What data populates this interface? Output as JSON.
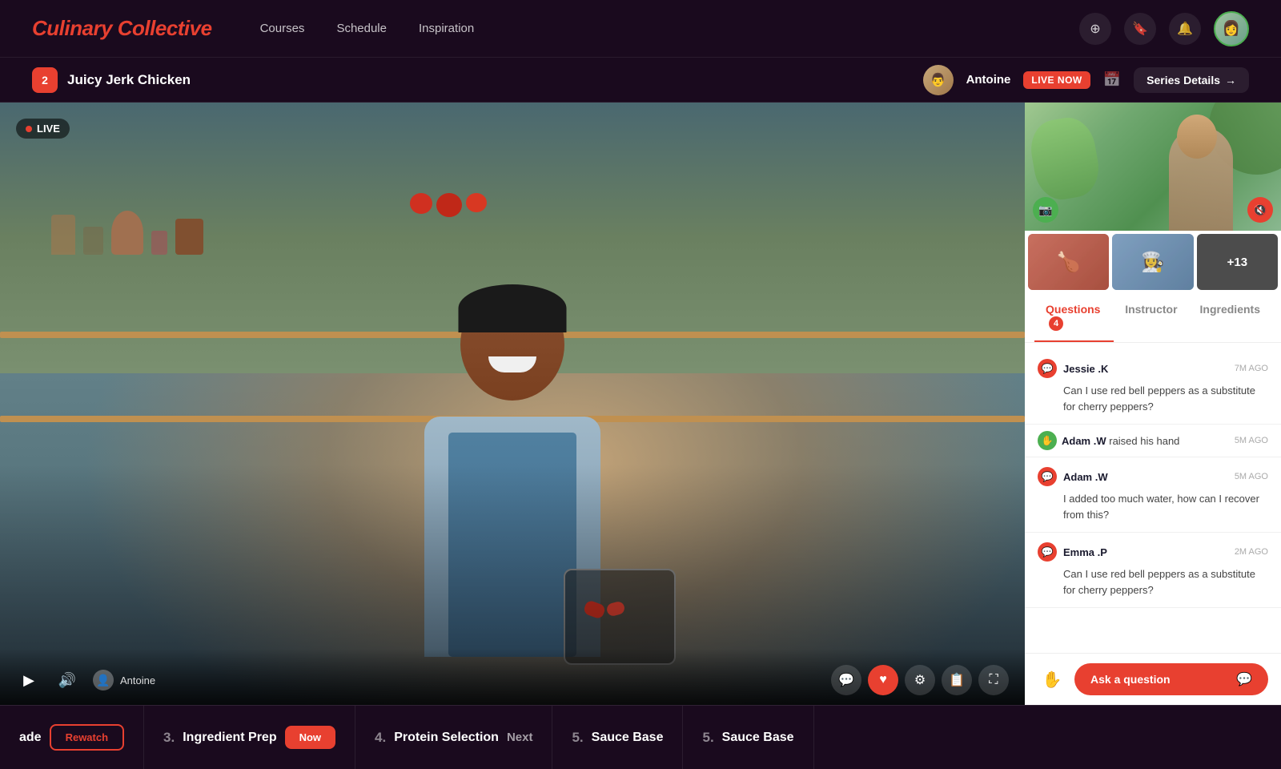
{
  "brand": {
    "name": "Culinary Collective",
    "color": "#e84030"
  },
  "navbar": {
    "links": [
      "Courses",
      "Schedule",
      "Inspiration"
    ]
  },
  "breadcrumb": {
    "episode_number": "2",
    "episode_title": "Juicy Jerk Chicken",
    "instructor_name": "Antoine",
    "live_label": "LIVE NOW",
    "series_details_label": "Series Details"
  },
  "video": {
    "live_label": "LIVE",
    "instructor_label": "Antoine"
  },
  "sidebar": {
    "more_count": "+13",
    "tabs": [
      {
        "label": "Questions",
        "badge": "4",
        "active": true
      },
      {
        "label": "Instructor",
        "badge": "",
        "active": false
      },
      {
        "label": "Ingredients",
        "badge": "",
        "active": false
      }
    ],
    "questions": [
      {
        "avatar_type": "red",
        "avatar_initials": "💬",
        "name": "Jessie .K",
        "time": "7M AGO",
        "text": "Can I use red bell peppers as a substitute for cherry peppers?"
      },
      {
        "avatar_type": "green",
        "avatar_initials": "✋",
        "name": "Adam .W",
        "time": "5M AGO",
        "hand_raised": true,
        "hand_text": "raised his hand"
      },
      {
        "avatar_type": "red",
        "avatar_initials": "💬",
        "name": "Adam .W",
        "time": "5M AGO",
        "text": "I added too much water, how can I recover from this?"
      },
      {
        "avatar_type": "red",
        "avatar_initials": "💬",
        "name": "Emma .P",
        "time": "2M AGO",
        "text": "Can I use red bell peppers as a substitute for cherry peppers?"
      }
    ],
    "ask_label": "Ask a question"
  },
  "bottom_strip": {
    "items": [
      {
        "num": "",
        "title": "ade",
        "action": "rewatch",
        "action_label": "Rewatch"
      },
      {
        "num": "3.",
        "title": "Ingredient Prep",
        "action": "now",
        "action_label": "Now"
      },
      {
        "num": "4.",
        "title": "Protein Selection",
        "action": "next",
        "action_label": "Next"
      },
      {
        "num": "5.",
        "title": "Sauce Base",
        "action": "",
        "action_label": ""
      },
      {
        "num": "5.",
        "title": "Sauce Base",
        "action": "",
        "action_label": ""
      }
    ]
  }
}
